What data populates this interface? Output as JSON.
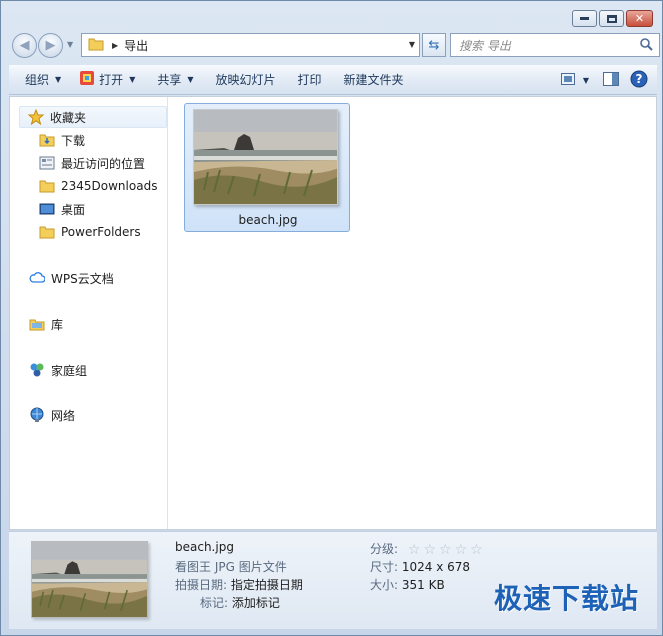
{
  "window": {
    "path": "导出"
  },
  "nav": {
    "search_placeholder": "搜索 导出"
  },
  "toolbar": {
    "organize": "组织",
    "open": "打开",
    "share": "共享",
    "slideshow": "放映幻灯片",
    "print": "打印",
    "new_folder": "新建文件夹"
  },
  "sidebar": {
    "favorites": "收藏夹",
    "items": [
      "下载",
      "最近访问的位置",
      "2345Downloads",
      "桌面",
      "PowerFolders"
    ],
    "wps": "WPS云文档",
    "library": "库",
    "homegroup": "家庭组",
    "network": "网络"
  },
  "files": [
    {
      "name": "beach.jpg"
    }
  ],
  "details": {
    "filename": "beach.jpg",
    "filetype": "看图王 JPG 图片文件",
    "date_label": "拍摄日期:",
    "date_value": "指定拍摄日期",
    "tags_label": "标记:",
    "tags_value": "添加标记",
    "rating_label": "分级:",
    "rating_value": 0,
    "dimensions_label": "尺寸:",
    "dimensions_value": "1024 x 678",
    "size_label": "大小:",
    "size_value": "351 KB"
  },
  "watermark": "极速下载站"
}
